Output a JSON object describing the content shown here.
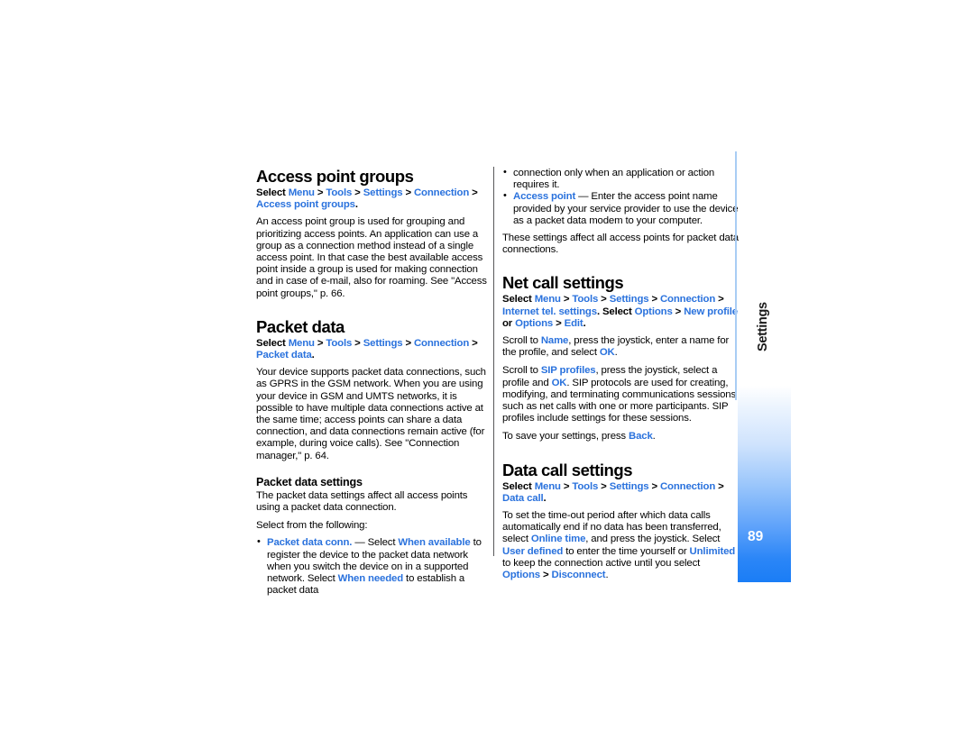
{
  "document": {
    "page_number": "89",
    "side_tab_label": "Settings",
    "link_color": "#2a72dd",
    "accent_color": "#1a7df6"
  },
  "left_column": {
    "section1": {
      "title": "Access point groups",
      "path": {
        "prefix": "Select ",
        "items": [
          "Menu",
          "Tools",
          "Settings",
          "Connection",
          "Access point groups"
        ],
        "separator": " > ",
        "suffix": "."
      },
      "body": "An access point group is used for grouping and prioritizing access points. An application can use a group as a connection method instead of a single access point. In that case the best available access point inside a group is used for making connection and in case of e-mail, also for roaming. See \"Access point groups,\" p. 66."
    },
    "section2": {
      "title": "Packet data",
      "path": {
        "prefix": "Select ",
        "items": [
          "Menu",
          "Tools",
          "Settings",
          "Connection",
          "Packet data"
        ],
        "separator": " > ",
        "suffix": "."
      },
      "body": "Your device supports packet data connections, such as GPRS in the GSM network. When you are using your device in GSM and UMTS networks, it is possible to have multiple data connections active at the same time; access points can share a data connection, and data connections remain active (for example, during voice calls). See \"Connection manager,\" p. 64.",
      "subsection": {
        "title": "Packet data settings",
        "body1": "The packet data settings affect all access points using a packet data connection.",
        "body2": "Select from the following:",
        "bullet1": {
          "term": "Packet data conn.",
          "dash": " — Select ",
          "value1": "When available",
          "mid": " to register the device to the packet data network when you switch the device on in a supported network. Select ",
          "value2": "When needed",
          "tail": " to establish a packet data"
        }
      }
    }
  },
  "right_column": {
    "continuation": "connection only when an application or action requires it.",
    "bullet_access_point": {
      "term": "Access point",
      "rest": " — Enter the access point name provided by your service provider to use the device as a packet data modem to your computer."
    },
    "after_bullets": "These settings affect all access points for packet data connections.",
    "section3": {
      "title": "Net call settings",
      "path": {
        "prefix": "Select ",
        "items": [
          "Menu",
          "Tools",
          "Settings",
          "Connection",
          "Internet tel. settings"
        ],
        "separator": " > ",
        "mid": ". Select ",
        "items2": [
          "Options",
          "New profile"
        ],
        "or": " or ",
        "items3": [
          "Options",
          "Edit"
        ],
        "suffix": "."
      },
      "para1": {
        "a": "Scroll to ",
        "link1": "Name",
        "b": ", press the joystick, enter a name for the profile, and select ",
        "link2": "OK",
        "c": "."
      },
      "para2": {
        "a": "Scroll to ",
        "link1": "SIP profiles",
        "b": ", press the joystick, select a profile and ",
        "link2": "OK",
        "c": ". SIP protocols are used for creating, modifying, and terminating communications sessions such as net calls with one or more participants. SIP profiles include settings for these sessions."
      },
      "para3": {
        "a": "To save your settings, press ",
        "link1": "Back",
        "b": "."
      }
    },
    "section4": {
      "title": "Data call settings",
      "path": {
        "prefix": "Select ",
        "items": [
          "Menu",
          "Tools",
          "Settings",
          "Connection",
          "Data call"
        ],
        "separator": " > ",
        "suffix": "."
      },
      "para1": {
        "a": "To set the time-out period after which data calls automatically end if no data has been transferred, select ",
        "link1": "Online time",
        "b": ", and press the joystick. Select ",
        "link2": "User defined",
        "c": " to enter the time yourself or ",
        "link3": "Unlimited",
        "d": " to keep the connection active until you select ",
        "link4": "Options",
        "e": " > ",
        "link5": "Disconnect",
        "f": "."
      }
    }
  }
}
